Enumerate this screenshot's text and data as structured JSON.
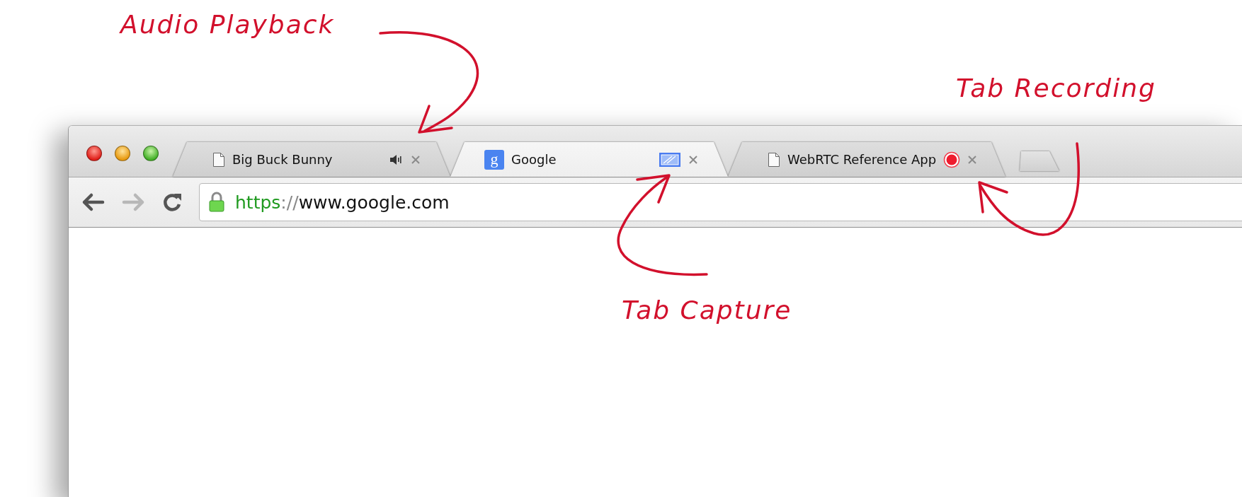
{
  "annotations": [
    {
      "text": "Audio Playback"
    },
    {
      "text": "Tab Recording"
    },
    {
      "text": "Tab Capture"
    }
  ],
  "window": {
    "tabs": [
      {
        "title": "Big Buck Bunny",
        "favicon": {
          "kind": "page"
        },
        "indicator": {
          "kind": "audio"
        },
        "selected": false
      },
      {
        "title": "Google",
        "favicon": {
          "kind": "letter",
          "text": "g"
        },
        "indicator": {
          "kind": "capture"
        },
        "selected": true
      },
      {
        "title": "WebRTC Reference App",
        "favicon": {
          "kind": "page"
        },
        "indicator": {
          "kind": "recording"
        },
        "selected": false
      }
    ],
    "toolbar": {
      "nav": [
        {
          "kind": "back",
          "disabled": false
        },
        {
          "kind": "forward",
          "disabled": true
        },
        {
          "kind": "reload",
          "disabled": false
        }
      ],
      "url": {
        "secure": true,
        "scheme": "https",
        "separator": "://",
        "host": "www.google.com"
      }
    }
  }
}
